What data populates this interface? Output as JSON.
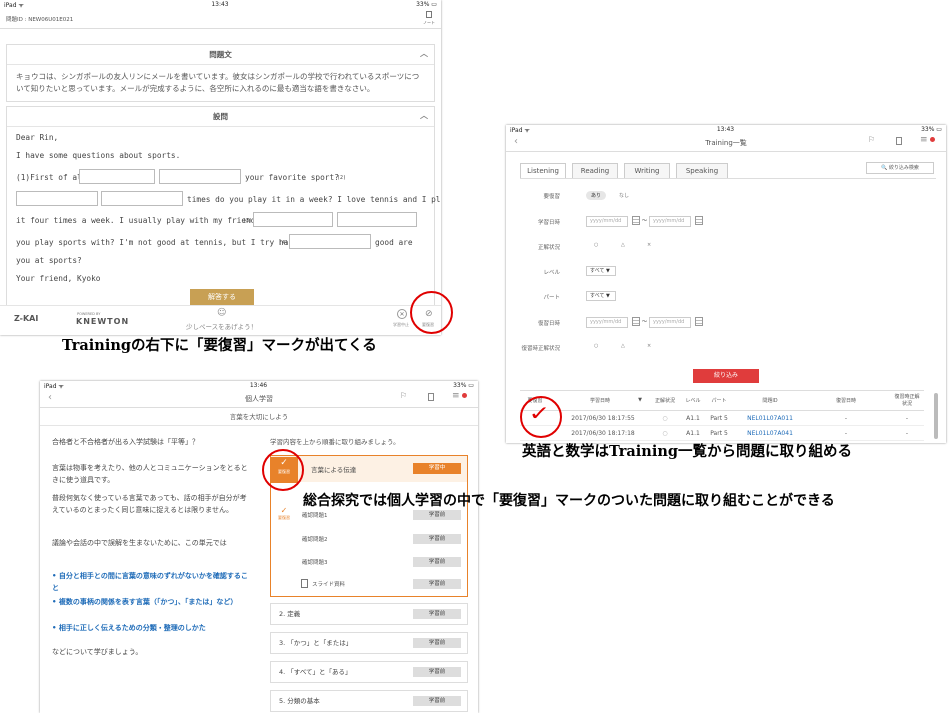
{
  "screenA": {
    "status": {
      "left": "iPad ᯤ",
      "time": "13:43",
      "right": "33% ▭"
    },
    "header": {
      "code": "問題ID : NEW06U01E021",
      "note_label": "ノート"
    },
    "prompt_section": {
      "title": "問題文",
      "text": "キョウコは、シンガポールの友人リンにメールを書いています。彼女はシンガポールの学校で行われているスポーツについて知りたいと思っています。メールが完成するように、各空所に入れるのに最も適当な語を書きなさい。"
    },
    "question_section": {
      "title": "設問",
      "lines": {
        "l1": "Dear Rin,",
        "l2": "I have some questions about sports.",
        "l3a": "(1)First of all,",
        "l3b": "your favorite sport?",
        "l3c": "(2)",
        "l4": "times do you play it in a week? I love tennis and I play",
        "l5a": "it four times a week. I usually play with my friends.",
        "l5b": "(3)",
        "l6a": "you play sports with? I'm not good at tennis, but I try hard.",
        "l6b": "(4)",
        "l6c": "good are",
        "l7": "you at sports?",
        "l8": "Your friend, Kyoko"
      },
      "submit_label": "解答する"
    },
    "footer": {
      "brand1": "Z-KAI",
      "brand2_small": "POWERED BY",
      "brand2": "KNEWTON",
      "center": "少しペースをあげよう！",
      "review_label": "要復習",
      "check_label": "学習中止"
    }
  },
  "captionA": "Trainingの右下に「要復習」マークが出てくる",
  "screenB": {
    "status": {
      "left": "iPad ᯤ",
      "time": "13:43",
      "right": "33% ▭"
    },
    "title": "Training一覧",
    "icons": [
      "ダイレクトン",
      "ノート",
      "メニュー"
    ],
    "tabs": [
      "Listening",
      "Reading",
      "Writing",
      "Speaking"
    ],
    "search_button": "🔍 絞り込み検索",
    "filters": {
      "review": {
        "label": "要復習",
        "opt1": "あり",
        "opt2": "なし"
      },
      "study_date": {
        "label": "学習日時",
        "from": "yyyy/mm/dd",
        "to": "yyyy/mm/dd",
        "sep": "〜"
      },
      "correct": {
        "label": "正解状況",
        "opts": [
          "○",
          "△",
          "×"
        ]
      },
      "level": {
        "label": "レベル",
        "value": "すべて ▼"
      },
      "part": {
        "label": "パート",
        "value": "すべて ▼"
      },
      "review_date": {
        "label": "復習日時",
        "from": "yyyy/mm/dd",
        "to": "yyyy/mm/dd",
        "sep": "〜"
      },
      "review_correct": {
        "label": "復習時正解状況",
        "opts": [
          "○",
          "△",
          "×"
        ]
      }
    },
    "filter_button": "絞り込み",
    "table": {
      "headers": [
        "要復習",
        "学習日時",
        "▼",
        "正解状況",
        "レベル",
        "パート",
        "問題ID",
        "復習日時",
        "復習時正解状況"
      ],
      "rows": [
        [
          "",
          "2017/06/30 18:17:55",
          "",
          "○",
          "A1.1",
          "Part 5",
          "NEL01L07A011",
          "-",
          "-"
        ],
        [
          "",
          "2017/06/30 18:17:18",
          "",
          "○",
          "A1.1",
          "Part 5",
          "NEL01L07A041",
          "-",
          "-"
        ]
      ]
    },
    "check_mark": "✓"
  },
  "captionB": "英語と数学はTraining一覧から問題に取り組める",
  "captionC": "総合探究では個人学習の中で「要復習」マークのついた問題に取り組むことができる",
  "screenC": {
    "status": {
      "left": "iPad ᯤ",
      "time": "13:46",
      "right": "33% ▭"
    },
    "title": "個人学習",
    "subtitle": "言葉を大切にしよう",
    "left": {
      "question": "合格者と不合格者が出る入学試験は「平等」？",
      "p1": "言葉は物事を考えたり、他の人とコミュニケーションをとるときに使う道具です。",
      "p2": "普段何気なく使っている言葉であっても、話の相手が自分が考えているのとまったく同じ意味に捉えるとは限りません。",
      "p3": "議論や会話の中で誤解を生まないために、この単元では",
      "b1": "• 自分と相手との間に言葉の意味のずれがないかを確認すること",
      "b2": "• 複数の事柄の関係を表す言葉（「かつ」、「または」など）",
      "b3": "• 相手に正しく伝えるための分類・整理のしかた",
      "p4": "などについて学びましょう。"
    },
    "right": {
      "intro": "学習内容を上から順番に取り組みましょう。",
      "review_mark": "要復習",
      "lessons": [
        {
          "title": "言葉による伝達",
          "btn": "学習中"
        },
        {
          "title": "確認問題1",
          "btn": "学習前"
        },
        {
          "title": "確認問題2",
          "btn": "学習前"
        },
        {
          "title": "確認問題3",
          "btn": "学習前"
        },
        {
          "title": "スライド資料",
          "btn": "学習前"
        },
        {
          "title": "2. 定義",
          "btn": "学習前"
        },
        {
          "title": "3. 「かつ」と「または」",
          "btn": "学習前"
        },
        {
          "title": "4. 「すべて」と「ある」",
          "btn": "学習前"
        },
        {
          "title": "5. 分類の基本",
          "btn": "学習前"
        }
      ]
    }
  },
  "colors": {
    "circle": "#e00000",
    "accent_orange": "#e8822a",
    "gold": "#c8a054",
    "blue_text": "#1e6bb8",
    "red_button": "#e03c3c"
  }
}
